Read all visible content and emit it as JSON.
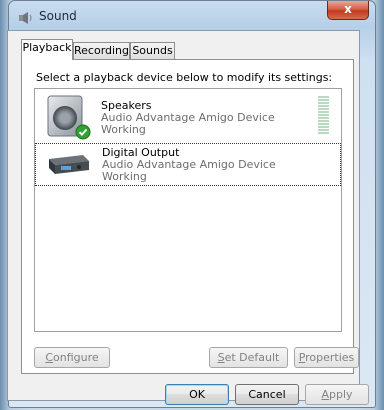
{
  "window": {
    "title": "Sound",
    "close_glyph": "x"
  },
  "tabs": [
    {
      "label": "Playback",
      "active": true
    },
    {
      "label": "Recording",
      "active": false
    },
    {
      "label": "Sounds",
      "active": false
    }
  ],
  "instruction": "Select a playback device below to modify its settings:",
  "devices": [
    {
      "name": "Speakers",
      "description": "Audio Advantage Amigo Device",
      "status": "Working",
      "icon": "speaker-icon",
      "default": true,
      "selected": false
    },
    {
      "name": "Digital Output",
      "description": "Audio Advantage Amigo Device",
      "status": "Working",
      "icon": "digital-output-icon",
      "default": false,
      "selected": true
    }
  ],
  "buttons": {
    "configure": {
      "mnemonic": "C",
      "rest": "onfigure"
    },
    "set_default": {
      "mnemonic": "S",
      "rest": "et Default"
    },
    "properties": {
      "mnemonic": "P",
      "rest": "roperties"
    },
    "ok": "OK",
    "cancel": "Cancel",
    "apply": {
      "mnemonic": "A",
      "rest": "pply"
    }
  },
  "colors": {
    "default_check": "#2fa32f",
    "meter_segment": "#b8d9c2"
  }
}
